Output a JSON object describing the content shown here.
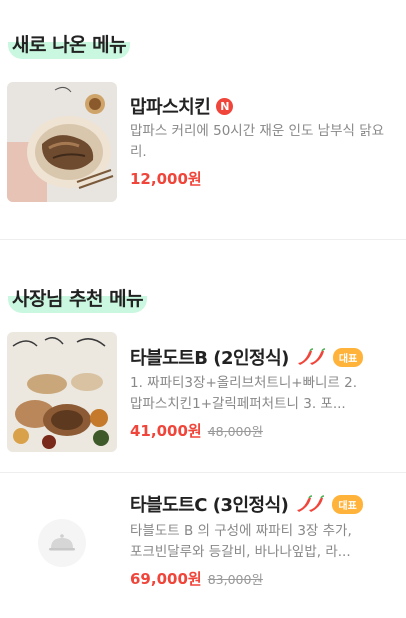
{
  "sections": [
    {
      "title": "새로 나온 메뉴",
      "items": [
        {
          "name": "맙파스치킨",
          "badge": "N",
          "description": "맙파스 커리에 50시간 재운 인도 남부식 닭요리.",
          "price": "12,000원",
          "thumb_icon": "food-photo-chicken-dish"
        }
      ]
    },
    {
      "title": "사장님 추천 메뉴",
      "items": [
        {
          "name": "타블도트B (2인정식)",
          "spicy_icon": "chili-pepper-icon",
          "rep_badge": "대표",
          "description_lines": [
            "1. 짜파티3장+올리브처트니+빠니르 2.",
            "맙파스치킨1+갈릭페퍼처트니 3. 포..."
          ],
          "price": "41,000원",
          "original_price": "48,000원",
          "thumb_icon": "food-photo-table-spread"
        },
        {
          "name": "타블도트C (3인정식)",
          "spicy_icon": "chili-pepper-icon",
          "rep_badge": "대표",
          "description_lines": [
            "타블도트 B 의 구성에 짜파티 3장 추가,",
            "포크빈달루와 등갈비, 바나나잎밥, 라..."
          ],
          "price": "69,000원",
          "original_price": "83,000원",
          "thumb_icon": "cloche-icon"
        }
      ]
    }
  ],
  "colors": {
    "accent_red": "#f0453a",
    "highlight_mint": "#c9f7df",
    "badge_orange": "#ffb33b"
  }
}
